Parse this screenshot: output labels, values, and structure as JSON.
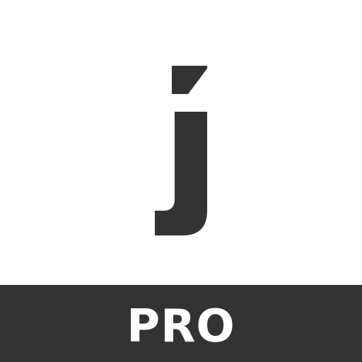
{
  "logo": {
    "glyph": "j",
    "icon": "j-accent-logo-icon",
    "color": "#333333"
  },
  "banner": {
    "label": "PRO",
    "background": "#333333",
    "text_color": "#ffffff"
  },
  "background": "#ffffff"
}
